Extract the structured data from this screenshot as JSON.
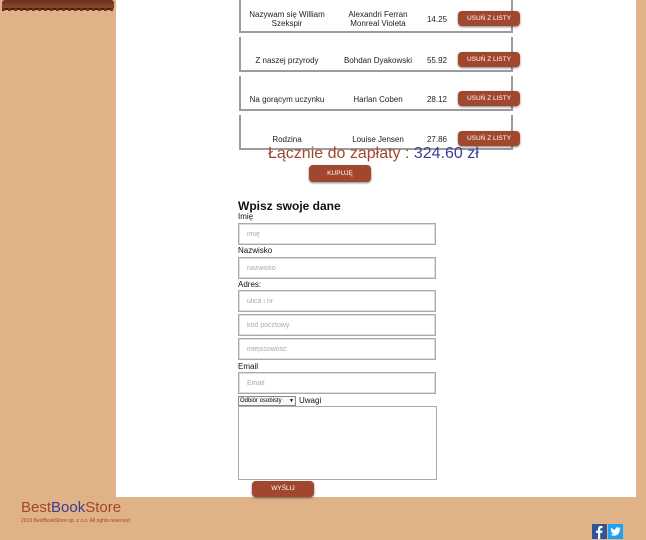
{
  "cart": {
    "rows": [
      {
        "title": "Nazywam się William Szekspir",
        "author": "Alexandri Ferran Monreal Violeta",
        "price": "14.25",
        "remove_label": "USUŃ Z LISTY"
      },
      {
        "title": "Z naszej przyrody",
        "author": "Bohdan Dyakowski",
        "price": "55.92",
        "remove_label": "USUŃ Z LISTY"
      },
      {
        "title": "Na gorącym uczynku",
        "author": "Harlan Coben",
        "price": "28.12",
        "remove_label": "USUŃ Z LISTY"
      },
      {
        "title": "Rodzina",
        "author": "Louise Jensen",
        "price": "27.86",
        "remove_label": "USUŃ Z LISTY"
      }
    ],
    "total_label": "Łącznie do zapłaty : ",
    "total_value": "324.60 zł",
    "buy_label": "KUPUJĘ"
  },
  "form": {
    "title": "Wpisz swoje dane",
    "first_name_label": "Imię",
    "first_name_placeholder": "imię",
    "last_name_label": "Nazwisko",
    "last_name_placeholder": "nazwisko",
    "address_label": "Adres:",
    "street_placeholder": "ulica i nr",
    "postal_placeholder": "kod pocztowy",
    "city_placeholder": "miejscowość",
    "email_label": "Email",
    "email_placeholder": "Email",
    "delivery_selected": "Odbiór osobisty",
    "notes_label": "Uwagi",
    "send_label": "WYŚLIJ"
  },
  "footer": {
    "brand_part1": "Best",
    "brand_part2": "Book",
    "brand_part3": "Store",
    "copyright": "2019 BestBookStore sp. z o.o. All rights reserved"
  },
  "icons": {
    "facebook": "facebook-icon",
    "twitter": "twitter-icon"
  },
  "colors": {
    "accent": "#a0472e",
    "brand_blue": "#3b3f8f",
    "background": "#e0b287"
  }
}
